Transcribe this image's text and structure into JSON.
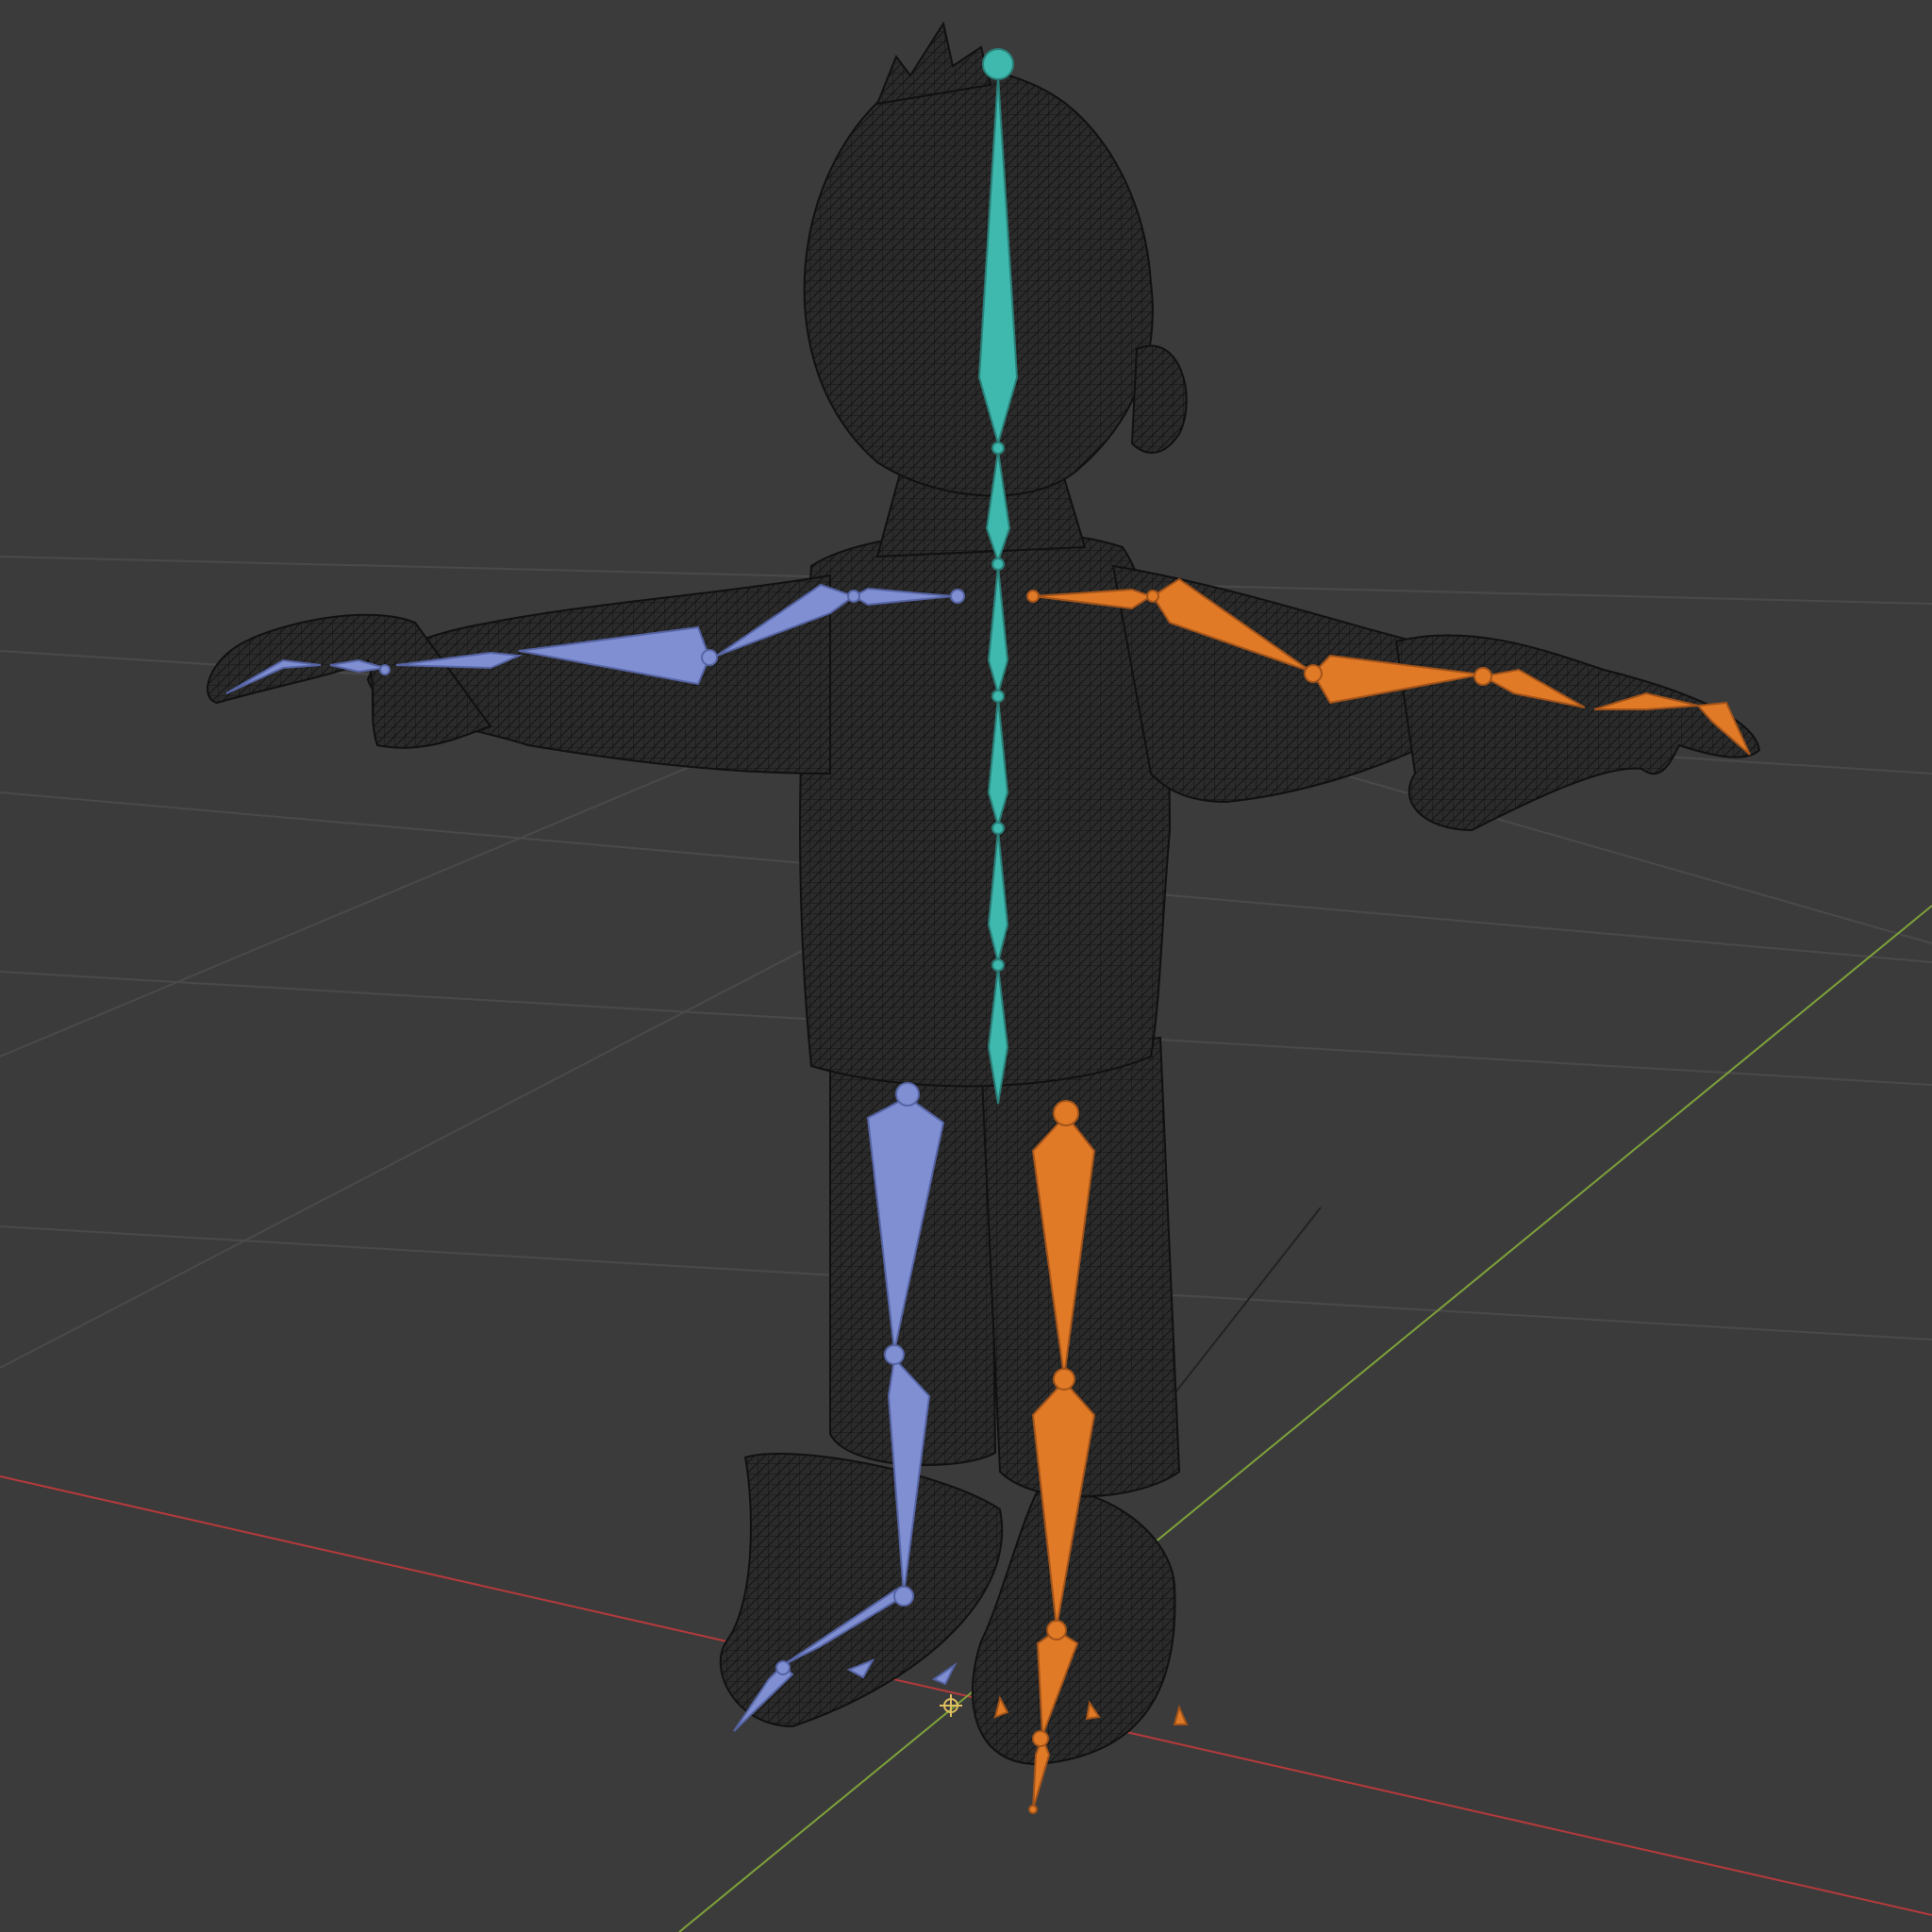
{
  "viewport": {
    "background": "#3b3b3b",
    "mode": "wireframe",
    "object": "character-mesh",
    "armature": "character-rig"
  },
  "colors": {
    "grid": "#4a4a4a",
    "axis_x": "#c0393b",
    "axis_y": "#8db33b",
    "wire": "#141414",
    "bone_center": "#3fb8ad",
    "bone_left": "#7f8fd2",
    "bone_right": "#e07a27"
  },
  "icons": {
    "origin": "origin-icon"
  }
}
